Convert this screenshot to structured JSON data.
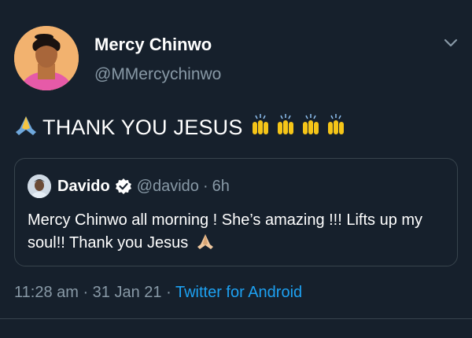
{
  "tweet": {
    "author_name": "Mercy Chinwo",
    "author_handle": "@MMercychinwo",
    "text": "THANK YOU JESUS",
    "timestamp": "11:28 am · 31 Jan 21 · ",
    "source": "Twitter for Android",
    "icons": {
      "leading": "praying-hands-emoji",
      "trailing": "raising-hands-emoji",
      "menu": "chevron-down-icon"
    }
  },
  "quoted_tweet": {
    "author_name": "Davido",
    "author_handle": "@davido",
    "separator": "·",
    "age": "6h",
    "text": "Mercy Chinwo all morning ! She’s amazing !!! Lifts up my soul!! Thank you Jesus",
    "verified": true,
    "trailing_icon": "praying-hands-emoji"
  },
  "colors": {
    "background": "#16202c",
    "secondary_text": "#8899a6",
    "link": "#1da1f2",
    "border": "#38444d"
  }
}
